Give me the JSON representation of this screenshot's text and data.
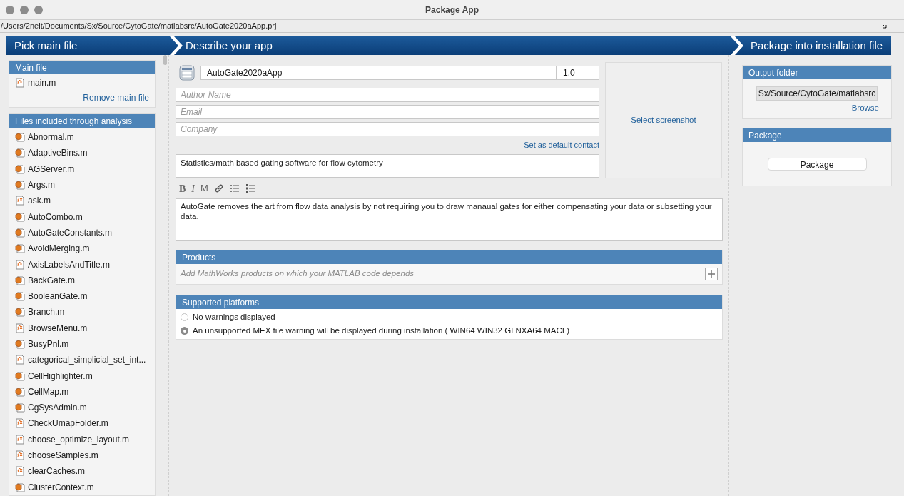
{
  "window": {
    "title": "Package App"
  },
  "path": "/Users/2neit/Documents/Sx/Source/CytoGate/matlabsrc/AutoGate2020aApp.prj",
  "steps": [
    "Pick main file",
    "Describe your app",
    "Package into installation file"
  ],
  "main_file": {
    "title": "Main file",
    "file": {
      "name": "main.m",
      "kind": "function"
    },
    "remove_link": "Remove main file"
  },
  "files": {
    "title": "Files included through analysis",
    "items": [
      {
        "name": "Abnormal.m",
        "kind": "class"
      },
      {
        "name": "AdaptiveBins.m",
        "kind": "class"
      },
      {
        "name": "AGServer.m",
        "kind": "class"
      },
      {
        "name": "Args.m",
        "kind": "class"
      },
      {
        "name": "ask.m",
        "kind": "function"
      },
      {
        "name": "AutoCombo.m",
        "kind": "class"
      },
      {
        "name": "AutoGateConstants.m",
        "kind": "class"
      },
      {
        "name": "AvoidMerging.m",
        "kind": "class"
      },
      {
        "name": "AxisLabelsAndTitle.m",
        "kind": "function"
      },
      {
        "name": "BackGate.m",
        "kind": "class"
      },
      {
        "name": "BooleanGate.m",
        "kind": "class"
      },
      {
        "name": "Branch.m",
        "kind": "class"
      },
      {
        "name": "BrowseMenu.m",
        "kind": "function"
      },
      {
        "name": "BusyPnl.m",
        "kind": "class"
      },
      {
        "name": "categorical_simplicial_set_int...",
        "kind": "function"
      },
      {
        "name": "CellHighlighter.m",
        "kind": "class"
      },
      {
        "name": "CellMap.m",
        "kind": "class"
      },
      {
        "name": "CgSysAdmin.m",
        "kind": "class"
      },
      {
        "name": "CheckUmapFolder.m",
        "kind": "function"
      },
      {
        "name": "choose_optimize_layout.m",
        "kind": "function"
      },
      {
        "name": "chooseSamples.m",
        "kind": "function"
      },
      {
        "name": "clearCaches.m",
        "kind": "function"
      },
      {
        "name": "ClusterContext.m",
        "kind": "class"
      }
    ]
  },
  "app": {
    "name": "AutoGate2020aApp",
    "version": "1.0",
    "author": {
      "placeholder": "Author Name"
    },
    "email": {
      "placeholder": "Email"
    },
    "company": {
      "placeholder": "Company"
    },
    "default_contact_link": "Set as default contact",
    "summary": "Statistics/math based gating software for flow cytometry",
    "format_buttons": [
      "B",
      "I",
      "M"
    ],
    "description": "AutoGate removes the art from flow data analysis by not requiring you to draw manaual gates for either compensating your data or subsetting your data.",
    "screenshot_link": "Select screenshot"
  },
  "products": {
    "title": "Products",
    "placeholder": "Add MathWorks products on which your MATLAB code depends"
  },
  "platforms": {
    "title": "Supported platforms",
    "options": [
      {
        "label": "No warnings displayed",
        "selected": false
      },
      {
        "label": "An unsupported MEX file warning will be displayed during installation ( WIN64 WIN32 GLNXA64 MACI )",
        "selected": true
      }
    ]
  },
  "output_folder": {
    "title": "Output folder",
    "value": "Sx/Source/CytoGate/matlabsrc",
    "browse_link": "Browse"
  },
  "package": {
    "title": "Package",
    "button": "Package"
  }
}
